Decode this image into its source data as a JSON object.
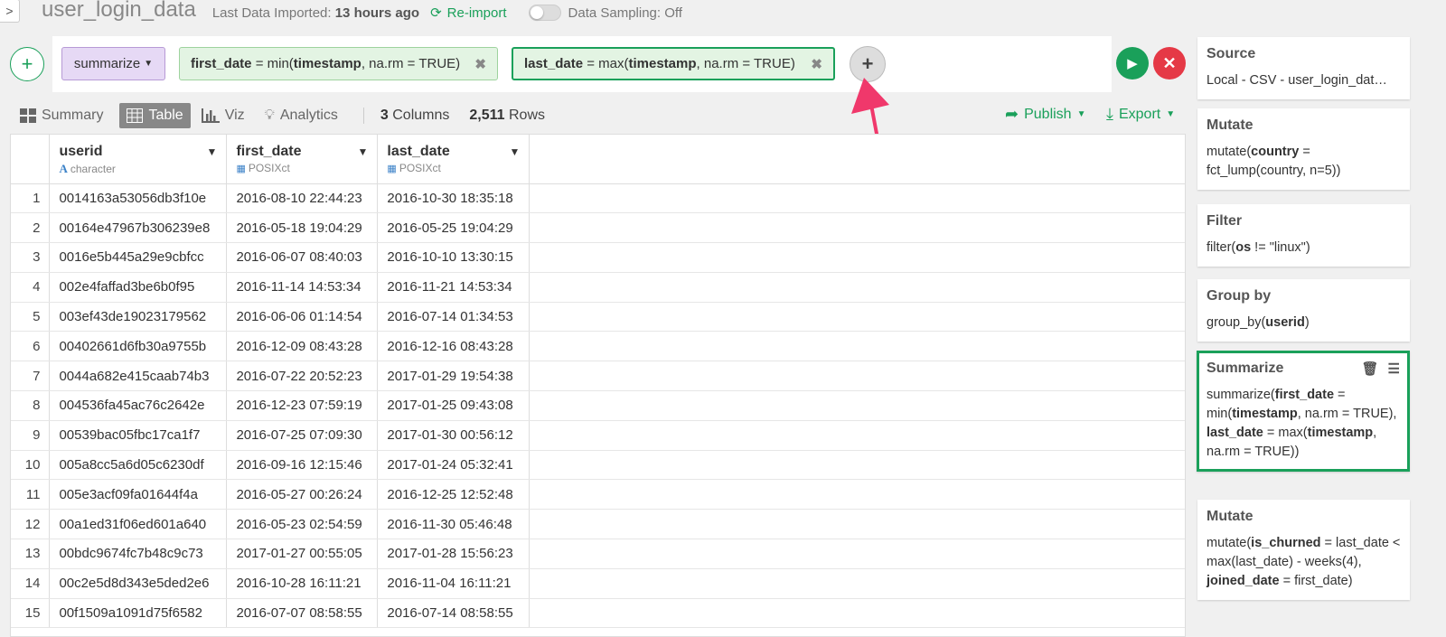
{
  "header": {
    "back_label": ">",
    "title": "user_login_data",
    "imported_prefix": "Last Data Imported:",
    "imported_value": "13 hours ago",
    "reimport_label": "Re-import",
    "sampling_label": "Data Sampling: Off"
  },
  "command": {
    "summarize_label": "summarize",
    "first_parts": [
      "first_date",
      " = min(",
      "timestamp",
      ", na.rm = TRUE)"
    ],
    "last_parts": [
      "last_date",
      " = max(",
      "timestamp",
      ", na.rm = TRUE)"
    ],
    "remove_glyph": "✖",
    "add_glyph": "+"
  },
  "view": {
    "tabs": [
      "Summary",
      "Table",
      "Viz",
      "Analytics"
    ],
    "active_tab": "Table",
    "columns_count": "3",
    "columns_label": "Columns",
    "rows_count": "2,511",
    "rows_label": "Rows",
    "publish_label": "Publish",
    "export_label": "Export"
  },
  "table": {
    "columns": [
      {
        "name": "userid",
        "type": "character"
      },
      {
        "name": "first_date",
        "type": "POSIXct"
      },
      {
        "name": "last_date",
        "type": "POSIXct"
      }
    ],
    "rows": [
      [
        "1",
        "0014163a53056db3f10e",
        "2016-08-10 22:44:23",
        "2016-10-30 18:35:18"
      ],
      [
        "2",
        "00164e47967b306239e8",
        "2016-05-18 19:04:29",
        "2016-05-25 19:04:29"
      ],
      [
        "3",
        "0016e5b445a29e9cbfcc",
        "2016-06-07 08:40:03",
        "2016-10-10 13:30:15"
      ],
      [
        "4",
        "002e4faffad3be6b0f95",
        "2016-11-14 14:53:34",
        "2016-11-21 14:53:34"
      ],
      [
        "5",
        "003ef43de19023179562",
        "2016-06-06 01:14:54",
        "2016-07-14 01:34:53"
      ],
      [
        "6",
        "00402661d6fb30a9755b",
        "2016-12-09 08:43:28",
        "2016-12-16 08:43:28"
      ],
      [
        "7",
        "0044a682e415caab74b3",
        "2016-07-22 20:52:23",
        "2017-01-29 19:54:38"
      ],
      [
        "8",
        "004536fa45ac76c2642e",
        "2016-12-23 07:59:19",
        "2017-01-25 09:43:08"
      ],
      [
        "9",
        "00539bac05fbc17ca1f7",
        "2016-07-25 07:09:30",
        "2017-01-30 00:56:12"
      ],
      [
        "10",
        "005a8cc5a6d05c6230df",
        "2016-09-16 12:15:46",
        "2017-01-24 05:32:41"
      ],
      [
        "11",
        "005e3acf09fa01644f4a",
        "2016-05-27 00:26:24",
        "2016-12-25 12:52:48"
      ],
      [
        "12",
        "00a1ed31f06ed601a640",
        "2016-05-23 02:54:59",
        "2016-11-30 05:46:48"
      ],
      [
        "13",
        "00bdc9674fc7b48c9c73",
        "2017-01-27 00:55:05",
        "2017-01-28 15:56:23"
      ],
      [
        "14",
        "00c2e5d8d343e5ded2e6",
        "2016-10-28 16:11:21",
        "2016-11-04 16:11:21"
      ],
      [
        "15",
        "00f1509a1091d75f6582",
        "2016-07-07 08:58:55",
        "2016-07-14 08:58:55"
      ]
    ]
  },
  "steps": [
    {
      "title": "Source",
      "body_html": "Local - CSV - user_login_dat…"
    },
    {
      "title": "Mutate",
      "body_html": "mutate(<b>country</b> = fct_lump(country, n=5))"
    },
    {
      "title": "Filter",
      "body_html": "filter(<b>os</b> != \"linux\")"
    },
    {
      "title": "Group by",
      "body_html": "group_by(<b>userid</b>)"
    },
    {
      "title": "Summarize",
      "body_html": "summarize(<b>first_date</b> = min(<b>timestamp</b>, na.rm = TRUE), <b>last_date</b> = max(<b>timestamp</b>, na.rm = TRUE))",
      "selected": true
    },
    {
      "title": "Mutate",
      "body_html": "mutate(<b>is_churned</b> = last_date &lt; max(last_date) - weeks(4), <b>joined_date</b> = first_date)"
    }
  ],
  "colors": {
    "accent_green": "#1aa05a",
    "cancel_red": "#e53946",
    "summarize_purple": "#e6d9f5",
    "arrow_pink": "#f0386b"
  }
}
